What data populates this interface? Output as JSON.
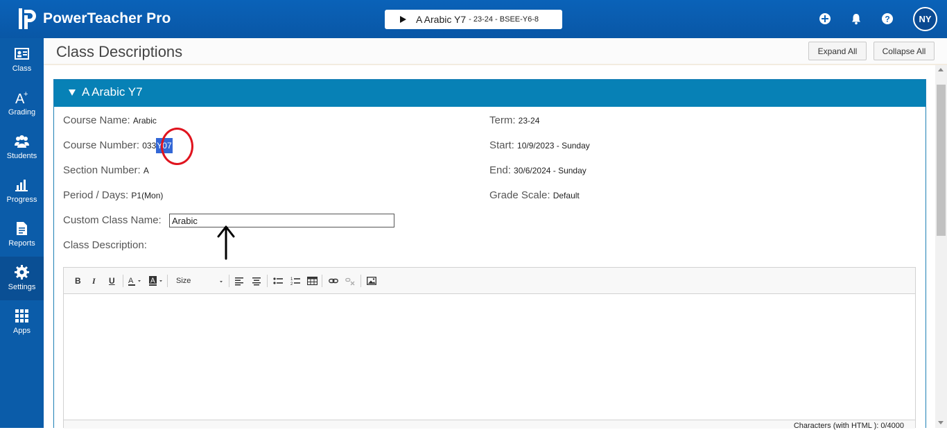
{
  "app": {
    "title": "PowerTeacher Pro",
    "avatar_initials": "NY"
  },
  "class_selector": {
    "name": "A Arabic Y7",
    "detail": "- 23-24 - BSEE-Y6-8"
  },
  "nav": [
    {
      "label": "Class",
      "icon": "class-icon"
    },
    {
      "label": "Grading",
      "icon": "grading-icon"
    },
    {
      "label": "Students",
      "icon": "students-icon"
    },
    {
      "label": "Progress",
      "icon": "progress-icon"
    },
    {
      "label": "Reports",
      "icon": "reports-icon"
    },
    {
      "label": "Settings",
      "icon": "settings-icon",
      "active": true
    },
    {
      "label": "Apps",
      "icon": "apps-icon"
    }
  ],
  "header": {
    "title": "Class Descriptions",
    "expand_label": "Expand All",
    "collapse_label": "Collapse All"
  },
  "panel": {
    "title": "A Arabic Y7",
    "course_name": {
      "label": "Course Name:",
      "value": "Arabic"
    },
    "course_number": {
      "label": "Course Number:",
      "value_plain": "03",
      "value_partial": "3",
      "value_highlight": "Y07"
    },
    "section_number": {
      "label": "Section Number:",
      "value": "A"
    },
    "period_days": {
      "label": "Period / Days:",
      "value": "P1(Mon)"
    },
    "custom_class_name": {
      "label": "Custom Class Name:",
      "value": "Arabic"
    },
    "class_description": {
      "label": "Class Description:"
    },
    "term": {
      "label": "Term:",
      "value": "23-24"
    },
    "start": {
      "label": "Start:",
      "value": "10/9/2023 - Sunday"
    },
    "end": {
      "label": "End:",
      "value": "30/6/2024 - Sunday"
    },
    "grade_scale": {
      "label": "Grade Scale:",
      "value": "Default"
    }
  },
  "editor": {
    "toolbar": {
      "bold": "B",
      "italic": "I",
      "underline": "U",
      "size": "Size"
    },
    "char_count": "Characters (with HTML ): 0/4000"
  },
  "colors": {
    "topbar": "#0a62b8",
    "panel_header": "#0781b6",
    "highlight": "#3367d6",
    "annotation_red": "#e0141e"
  }
}
